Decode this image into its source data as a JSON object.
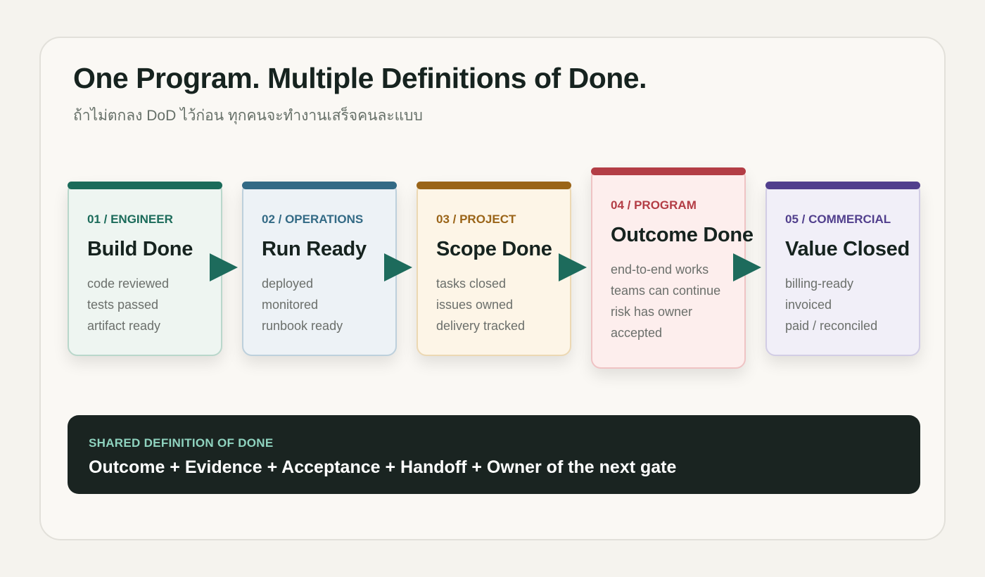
{
  "title": "One Program. Multiple Definitions of Done.",
  "subtitle": "ถ้าไม่ตกลง DoD ไว้ก่อน ทุกคนจะทำงานเสร็จคนละแบบ",
  "cards": [
    {
      "tag": "01 / ENGINEER",
      "title": "Build Done",
      "items": [
        "code reviewed",
        "tests passed",
        "artifact ready"
      ],
      "accent": "#1b6b5a",
      "bg": "#eef5f1",
      "border": "#b9d7cb"
    },
    {
      "tag": "02 / OPERATIONS",
      "title": "Run Ready",
      "items": [
        "deployed",
        "monitored",
        "runbook ready"
      ],
      "accent": "#336a85",
      "bg": "#edf2f6",
      "border": "#bdd0dc"
    },
    {
      "tag": "03 / PROJECT",
      "title": "Scope Done",
      "items": [
        "tasks closed",
        "issues owned",
        "delivery tracked"
      ],
      "accent": "#9a6418",
      "bg": "#fdf5e7",
      "border": "#ecd8b3"
    },
    {
      "tag": "04 / PROGRAM",
      "title": "Outcome Done",
      "items": [
        "end-to-end works",
        "teams can continue",
        "risk has owner",
        "accepted"
      ],
      "accent": "#b33d45",
      "bg": "#fdeeed",
      "border": "#efc3c4"
    },
    {
      "tag": "05 / COMMERCIAL",
      "title": "Value Closed",
      "items": [
        "billing-ready",
        "invoiced",
        "paid / reconciled"
      ],
      "accent": "#513f8d",
      "bg": "#f1eff8",
      "border": "#d2cde5"
    }
  ],
  "shared": {
    "label": "SHARED DEFINITION OF DONE",
    "formula": "Outcome + Evidence + Acceptance + Handoff + Owner of the next gate"
  }
}
